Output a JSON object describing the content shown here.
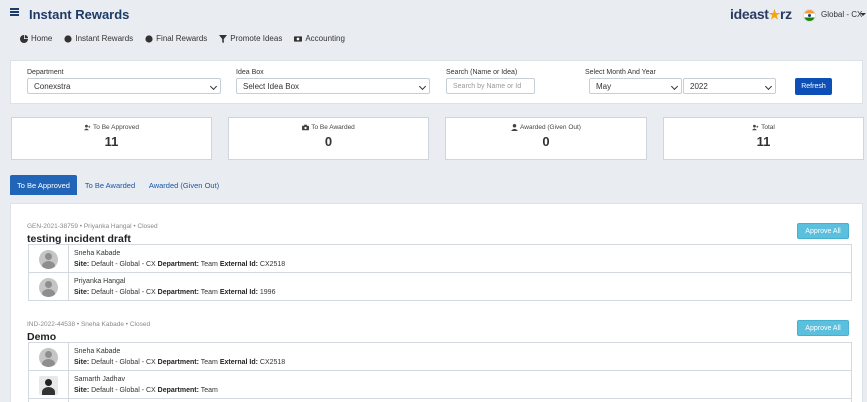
{
  "header": {
    "title": "Instant Rewards",
    "logo_main": "ideast",
    "logo_end": "rz",
    "region": "Global - CX"
  },
  "nav": [
    {
      "label": "Home",
      "icon": "chart-pie-icon"
    },
    {
      "label": "Instant Rewards",
      "icon": "badge-icon"
    },
    {
      "label": "Final Rewards",
      "icon": "badge-icon"
    },
    {
      "label": "Promote Ideas",
      "icon": "filter-icon"
    },
    {
      "label": "Accounting",
      "icon": "money-icon"
    }
  ],
  "filters": {
    "department_label": "Department",
    "department_value": "Conexstra",
    "ideabox_label": "Idea Box",
    "ideabox_value": "Select Idea Box",
    "search_label": "Search (Name or Idea)",
    "search_placeholder": "Search by Name or Id",
    "month_year_label": "Select Month And Year",
    "month_value": "May",
    "year_value": "2022",
    "refresh_label": "Refresh"
  },
  "stats": [
    {
      "label": "To Be Approved",
      "value": "11",
      "icon": "user-plus-icon"
    },
    {
      "label": "To Be Awarded",
      "value": "0",
      "icon": "camera-icon"
    },
    {
      "label": "Awarded (Given Out)",
      "value": "0",
      "icon": "user-icon"
    },
    {
      "label": "Total",
      "value": "11",
      "icon": "user-plus-icon"
    }
  ],
  "tabs": [
    {
      "label": "To Be Approved",
      "active": true
    },
    {
      "label": "To Be Awarded",
      "active": false
    },
    {
      "label": "Awarded (Given Out)",
      "active": false
    }
  ],
  "ideas": [
    {
      "meta": "GEN-2021-38759 • Priyanka Hangal • Closed",
      "title": "testing incident draft",
      "approve_label": "Approve All",
      "users": [
        {
          "name": "Sneha Kabade",
          "site_label": "Site:",
          "site": "Default - Global - CX",
          "dept_label": "Department:",
          "dept": "Team",
          "ext_label": "External Id:",
          "ext": "CX2518"
        },
        {
          "name": "Priyanka Hangal",
          "site_label": "Site:",
          "site": "Default - Global - CX",
          "dept_label": "Department:",
          "dept": "Team",
          "ext_label": "External Id:",
          "ext": "1996"
        }
      ]
    },
    {
      "meta": "IND-2022-44538 • Sneha Kabade • Closed",
      "title": "Demo",
      "approve_label": "Approve All",
      "users": [
        {
          "name": "Sneha Kabade",
          "site_label": "Site:",
          "site": "Default - Global - CX",
          "dept_label": "Department:",
          "dept": "Team",
          "ext_label": "External Id:",
          "ext": "CX2518"
        },
        {
          "name": "Samarth Jadhav",
          "site_label": "Site:",
          "site": "Default - Global - CX",
          "dept_label": "Department:",
          "dept": "Team",
          "ext_label": "",
          "ext": ""
        }
      ]
    }
  ],
  "colors": {
    "brand": "#1e3a66",
    "primary_button": "#0d4fb6",
    "tab_active": "#2065b8",
    "approve_button": "#5bc0de",
    "logo_star": "#f3a516"
  }
}
